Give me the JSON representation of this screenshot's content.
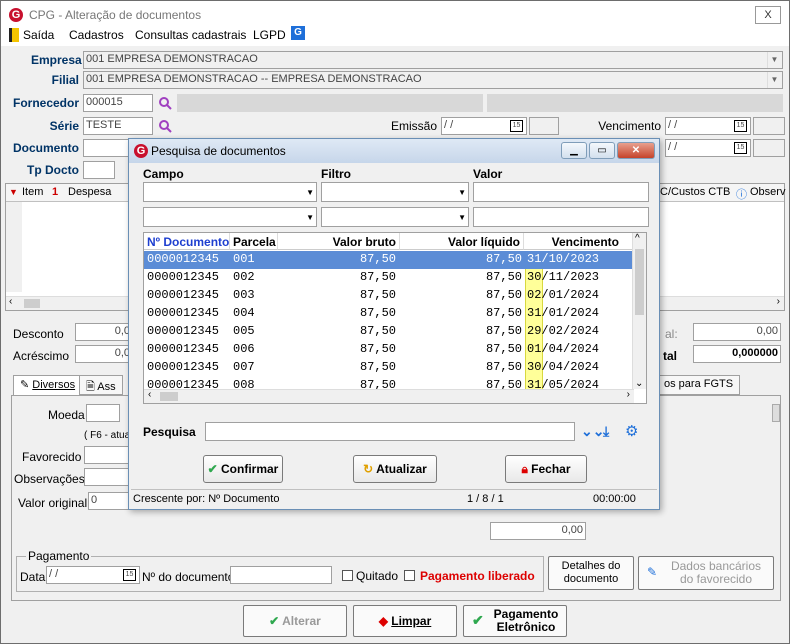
{
  "window": {
    "title": "CPG - Alteração de documentos",
    "close_glyph": "X"
  },
  "menu": {
    "items": [
      "Saída",
      "Cadastros",
      "Consultas cadastrais",
      "LGPD"
    ]
  },
  "form": {
    "empresa_label": "Empresa",
    "empresa_value": "001 EMPRESA DEMONSTRACAO",
    "filial_label": "Filial",
    "filial_value": "001 EMPRESA DEMONSTRACAO -- EMPRESA DEMONSTRACAO",
    "fornecedor_label": "Fornecedor",
    "fornecedor_value": "000015",
    "serie_label": "Série",
    "serie_value": "TESTE",
    "emissao_label": "Emissão",
    "emissao_value": "/ /",
    "vencimento_label": "Vencimento",
    "vencimento_value": "/ /",
    "documento_label": "Documento",
    "tpdocto_label": "Tp Docto",
    "cal_glyph": "15"
  },
  "grid": {
    "headers": [
      "Item",
      "Despesa",
      "C/Custos CTB",
      "Observ"
    ]
  },
  "totals": {
    "desconto_label": "Desconto",
    "desconto_value": "0,0",
    "acrescimo_label": "Acréscimo",
    "acrescimo_value": "0,0",
    "right_top_value": "0,00",
    "total_label": "tal",
    "total_value": "0,000000",
    "al_label": "al:"
  },
  "tabs": {
    "diversos": "Diversos",
    "ass": "Ass",
    "fgts": "os para FGTS"
  },
  "panel": {
    "moeda_label": "Moeda",
    "f6_text": "( F6 - atua",
    "favorecido_label": "Favorecido",
    "observacoes_label": "Observações",
    "valor_original_label": "Valor original",
    "valor_original_value": "0",
    "value_box": "0,00",
    "pagamento_label": "Pagamento",
    "data_label": "Data",
    "data_value": "/ /",
    "ndoc_label": "Nº do documento",
    "quitado_label": "Quitado",
    "liberado_label": "Pagamento liberado",
    "detalhes_label_1": "Detalhes do",
    "detalhes_label_2": "documento",
    "dados_label_1": "Dados bancários",
    "dados_label_2": "do favorecido"
  },
  "bottom_buttons": {
    "alterar": "Alterar",
    "limpar": "Limpar",
    "pagamento_1": "Pagamento",
    "pagamento_2": "Eletrônico"
  },
  "dialog": {
    "title": "Pesquisa de documentos",
    "campo_label": "Campo",
    "filtro_label": "Filtro",
    "valor_label": "Valor",
    "columns": [
      "Nº Documento",
      "Parcela",
      "Valor bruto",
      "Valor líquido",
      "Vencimento"
    ],
    "rows": [
      [
        "0000012345",
        "001",
        "87,50",
        "87,50",
        "31/10/2023"
      ],
      [
        "0000012345",
        "002",
        "87,50",
        "87,50",
        "30/11/2023"
      ],
      [
        "0000012345",
        "003",
        "87,50",
        "87,50",
        "02/01/2024"
      ],
      [
        "0000012345",
        "004",
        "87,50",
        "87,50",
        "31/01/2024"
      ],
      [
        "0000012345",
        "005",
        "87,50",
        "87,50",
        "29/02/2024"
      ],
      [
        "0000012345",
        "006",
        "87,50",
        "87,50",
        "01/04/2024"
      ],
      [
        "0000012345",
        "007",
        "87,50",
        "87,50",
        "30/04/2024"
      ],
      [
        "0000012345",
        "008",
        "87,50",
        "87,50",
        "31/05/2024"
      ]
    ],
    "pesquisa_label": "Pesquisa",
    "confirmar": "Confirmar",
    "atualizar": "Atualizar",
    "fechar": "Fechar",
    "status_sort": "Crescente por: Nº Documento",
    "status_pos": "1 / 8 / 1",
    "status_time": "00:00:00"
  },
  "colors": {
    "accent_blue": "#003366",
    "selected_row": "#5b8cd6",
    "highlight_yellow": "#ffff99",
    "red": "#c8102e"
  }
}
